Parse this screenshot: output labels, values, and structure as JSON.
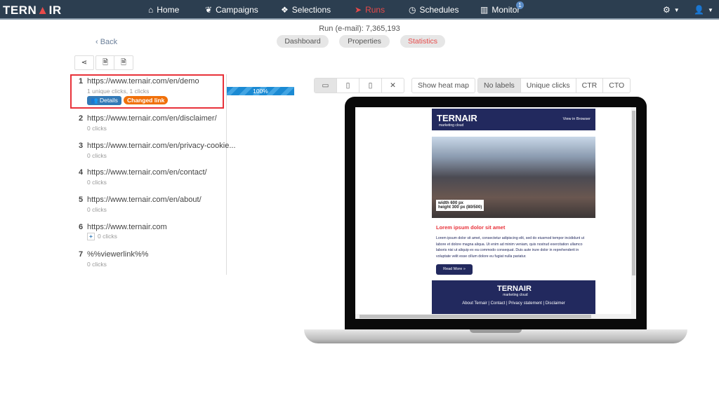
{
  "nav": {
    "logo": "TERNAIR",
    "items": [
      {
        "label": "Home",
        "icon": "home-icon"
      },
      {
        "label": "Campaigns",
        "icon": "leaf-icon"
      },
      {
        "label": "Selections",
        "icon": "cubes-icon"
      },
      {
        "label": "Runs",
        "icon": "paper-plane-icon"
      },
      {
        "label": "Schedules",
        "icon": "clock-icon"
      },
      {
        "label": "Monitor",
        "icon": "bar-chart-icon"
      }
    ],
    "monitor_badge": "1",
    "active": "Runs"
  },
  "header": {
    "run_title": "Run (e-mail): 7,365,193",
    "back": "‹ Back",
    "tabs": [
      "Dashboard",
      "Properties",
      "Statistics"
    ],
    "active_tab": "Statistics"
  },
  "links": [
    {
      "n": "1",
      "url": "https://www.ternair.com/en/demo",
      "stats": "1 unique clicks, 1 clicks",
      "details": "Details",
      "changed": "Changed link",
      "percent": "100%"
    },
    {
      "n": "2",
      "url": "https://www.ternair.com/en/disclaimer/",
      "stats": "0 clicks"
    },
    {
      "n": "3",
      "url": "https://www.ternair.com/en/privacy-cookie...",
      "stats": "0 clicks"
    },
    {
      "n": "4",
      "url": "https://www.ternair.com/en/contact/",
      "stats": "0 clicks"
    },
    {
      "n": "5",
      "url": "https://www.ternair.com/en/about/",
      "stats": "0 clicks"
    },
    {
      "n": "6",
      "url": "https://www.ternair.com",
      "stats": "0 clicks"
    },
    {
      "n": "7",
      "url": "%%viewerlink%%",
      "stats": "0 clicks"
    }
  ],
  "toolbar": {
    "heatmap": "Show heat map",
    "labels": [
      "No labels",
      "Unique clicks",
      "CTR",
      "CTO"
    ],
    "active_label": "No labels"
  },
  "email": {
    "logo": "TERNAIR",
    "logo_sub": "marketing cloud",
    "view_in_browser": "View in Browser",
    "img_label_1": "width 600 px",
    "img_label_2": "height 300 px (80/500)",
    "title": "Lorem ipsum dolor sit amet",
    "body": "Lorem ipsum dolor sit amet, consectetur adipiscing elit, sed do eiusmod tempor incididunt ut labore et dolore magna aliqua. Ut enim ad minim veniam, quis nostrud exercitation ullamco laboris nisi ut aliquip ex ea commodo consequat. Duis aute irure dolor in reprehenderit in voluptate velit esse cillum dolore eu fugiat nulla pariatur.",
    "button": "Read More »",
    "footer_links": "About Ternair  |  Contact  |  Privacy statement  |  Disclaimer"
  },
  "colors": {
    "nav": "#2c3e50",
    "accent": "#e84a4a",
    "details": "#337ab7",
    "changed": "#f0700a",
    "email_navy": "#22295e"
  }
}
